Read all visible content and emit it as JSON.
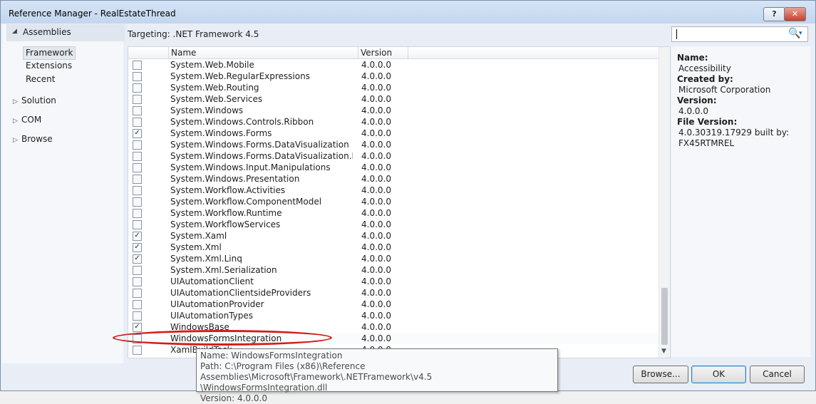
{
  "window": {
    "title": "Reference Manager - RealEstateThread",
    "help_label": "?",
    "close_label": "✕"
  },
  "nav": {
    "assemblies_label": "Assemblies",
    "framework_label": "Framework",
    "extensions_label": "Extensions",
    "recent_label": "Recent",
    "solution_label": "Solution",
    "com_label": "COM",
    "browse_label": "Browse"
  },
  "targeting": "Targeting: .NET Framework 4.5",
  "table": {
    "col_name": "Name",
    "col_version": "Version",
    "rows": [
      {
        "name": "System.Web.Mobile",
        "version": "4.0.0.0",
        "checked": false
      },
      {
        "name": "System.Web.RegularExpressions",
        "version": "4.0.0.0",
        "checked": false
      },
      {
        "name": "System.Web.Routing",
        "version": "4.0.0.0",
        "checked": false
      },
      {
        "name": "System.Web.Services",
        "version": "4.0.0.0",
        "checked": false
      },
      {
        "name": "System.Windows",
        "version": "4.0.0.0",
        "checked": false
      },
      {
        "name": "System.Windows.Controls.Ribbon",
        "version": "4.0.0.0",
        "checked": false
      },
      {
        "name": "System.Windows.Forms",
        "version": "4.0.0.0",
        "checked": true
      },
      {
        "name": "System.Windows.Forms.DataVisualization",
        "version": "4.0.0.0",
        "checked": false
      },
      {
        "name": "System.Windows.Forms.DataVisualization.Desi...",
        "version": "4.0.0.0",
        "checked": false
      },
      {
        "name": "System.Windows.Input.Manipulations",
        "version": "4.0.0.0",
        "checked": false
      },
      {
        "name": "System.Windows.Presentation",
        "version": "4.0.0.0",
        "checked": false
      },
      {
        "name": "System.Workflow.Activities",
        "version": "4.0.0.0",
        "checked": false
      },
      {
        "name": "System.Workflow.ComponentModel",
        "version": "4.0.0.0",
        "checked": false
      },
      {
        "name": "System.Workflow.Runtime",
        "version": "4.0.0.0",
        "checked": false
      },
      {
        "name": "System.WorkflowServices",
        "version": "4.0.0.0",
        "checked": false
      },
      {
        "name": "System.Xaml",
        "version": "4.0.0.0",
        "checked": true
      },
      {
        "name": "System.Xml",
        "version": "4.0.0.0",
        "checked": true
      },
      {
        "name": "System.Xml.Linq",
        "version": "4.0.0.0",
        "checked": true
      },
      {
        "name": "System.Xml.Serialization",
        "version": "4.0.0.0",
        "checked": false
      },
      {
        "name": "UIAutomationClient",
        "version": "4.0.0.0",
        "checked": false
      },
      {
        "name": "UIAutomationClientsideProviders",
        "version": "4.0.0.0",
        "checked": false
      },
      {
        "name": "UIAutomationProvider",
        "version": "4.0.0.0",
        "checked": false
      },
      {
        "name": "UIAutomationTypes",
        "version": "4.0.0.0",
        "checked": false
      },
      {
        "name": "WindowsBase",
        "version": "4.0.0.0",
        "checked": true
      },
      {
        "name": "WindowsFormsIntegration",
        "version": "4.0.0.0",
        "checked": false
      },
      {
        "name": "XamlBuildTask",
        "version": "4.0.0.0",
        "checked": false
      }
    ]
  },
  "tooltip": {
    "line1": "Name: WindowsFormsIntegration",
    "line2": "Path: C:\\Program Files (x86)\\Reference Assemblies\\Microsoft\\Framework\\.NETFramework\\v4.5",
    "line3": "\\WindowsFormsIntegration.dll",
    "line4": "Version: 4.0.0.0"
  },
  "details": {
    "name_label": "Name:",
    "name_value": "Accessibility",
    "created_label": "Created by:",
    "created_value": "Microsoft Corporation",
    "version_label": "Version:",
    "version_value": "4.0.0.0",
    "filever_label": "File Version:",
    "filever_value1": "4.0.30319.17929 built by:",
    "filever_value2": "FX45RTMREL"
  },
  "buttons": {
    "browse": "Browse...",
    "ok": "OK",
    "cancel": "Cancel"
  },
  "icons": {
    "search": "🔍",
    "dropdown": "▾",
    "expanded": "◢",
    "collapsed": "▷",
    "scroll_down": "▼",
    "check": "✓"
  }
}
